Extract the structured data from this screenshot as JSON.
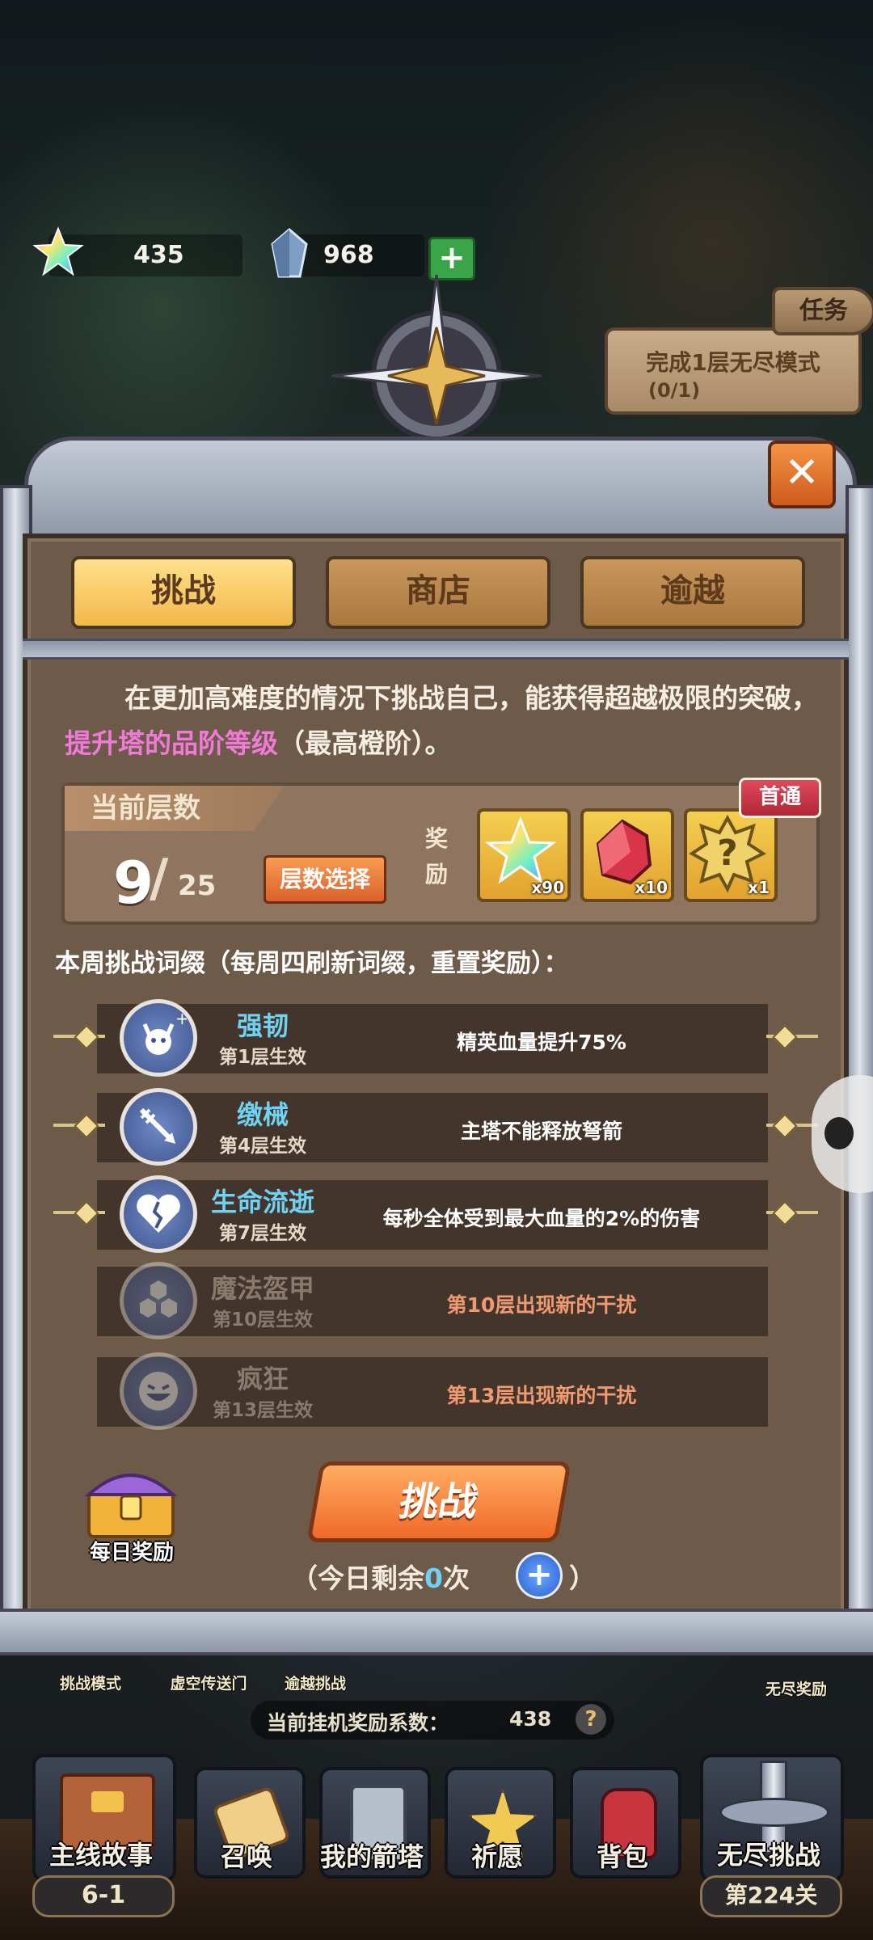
{
  "currencies": [
    {
      "icon": "rainbow-star-icon",
      "value": "435"
    },
    {
      "icon": "crystal-icon",
      "value": "968"
    }
  ],
  "task": {
    "tab_label": "任务",
    "text": "完成1层无尽模式",
    "progress": "(0/1)"
  },
  "tabs": [
    {
      "label": "挑战",
      "active": true
    },
    {
      "label": "商店",
      "active": false
    },
    {
      "label": "逾越",
      "active": false
    }
  ],
  "description": {
    "part1": "在更加高难度的情况下挑战自己，能获得超越极限的突破，",
    "highlight": "提升塔的品阶等级",
    "part2": "（最高橙阶）。"
  },
  "floor": {
    "header": "当前层数",
    "current": "9",
    "separator": "/",
    "total": "25",
    "select_button": "层数选择",
    "reward_label": "奖励",
    "first_clear_badge": "首通",
    "rewards": [
      {
        "icon": "rainbow-star-icon",
        "qty": "x90"
      },
      {
        "icon": "red-crystal-icon",
        "qty": "x10"
      },
      {
        "icon": "mystery-box-icon",
        "qty": "x1"
      }
    ]
  },
  "affix_header": "本周挑战词缀（每周四刷新词缀，重置奖励）：",
  "affixes": [
    {
      "icon": "demon-plus-icon",
      "name": "强韧",
      "floor": "第1层生效",
      "desc": "精英血量提升75%",
      "locked": false
    },
    {
      "icon": "broken-arrow-icon",
      "name": "缴械",
      "floor": "第4层生效",
      "desc": "主塔不能释放弩箭",
      "locked": false
    },
    {
      "icon": "broken-heart-icon",
      "name": "生命流逝",
      "floor": "第7层生效",
      "desc": "每秒全体受到最大血量的2%的伤害",
      "locked": false
    },
    {
      "icon": "hexagon-shield-icon",
      "name": "魔法盔甲",
      "floor": "第10层生效",
      "desc": "第10层出现新的干扰",
      "locked": true
    },
    {
      "icon": "grin-face-icon",
      "name": "疯狂",
      "floor": "第13层生效",
      "desc": "第13层出现新的干扰",
      "locked": true
    }
  ],
  "daily_reward": "每日奖励",
  "challenge_button": "挑战",
  "remaining": {
    "prefix": "（今日剩余",
    "count": "0",
    "suffix": "次"
  },
  "remaining_close": "）",
  "behind_panel": {
    "modes": [
      "挑战模式",
      "虚空传送门",
      "逾越挑战"
    ],
    "endless_reward": "无尽奖励",
    "idle_label": "当前挂机奖励系数：",
    "idle_value": "438"
  },
  "bottom_nav": [
    {
      "label": "主线故事",
      "sub": "6-1",
      "icon": "book-icon"
    },
    {
      "label": "召唤",
      "icon": "scroll-icon"
    },
    {
      "label": "我的箭塔",
      "icon": "tower-icon"
    },
    {
      "label": "祈愿",
      "icon": "star-emblem-icon"
    },
    {
      "label": "背包",
      "icon": "backpack-icon"
    },
    {
      "label": "无尽挑战",
      "sub": "第224关",
      "icon": "sword-wings-icon"
    }
  ],
  "colors": {
    "accent_orange": "#f06a28",
    "highlight_pink": "#f17ad8",
    "affix_blue": "#6fd2f2",
    "locked_orange": "#f09a72"
  }
}
